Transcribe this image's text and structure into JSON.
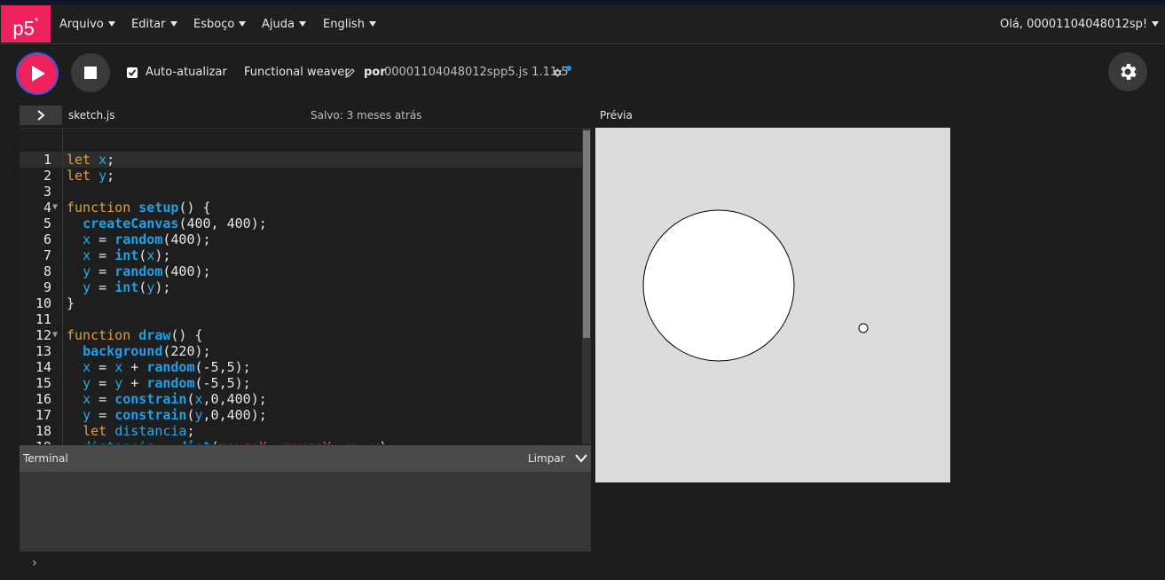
{
  "nav": {
    "logo": "p5",
    "logo_star": "*",
    "menus": [
      "Arquivo",
      "Editar",
      "Esboço",
      "Ajuda",
      "English"
    ],
    "user": "Olá, 00001104048012sp!"
  },
  "toolbar": {
    "auto_refresh": "Auto-atualizar",
    "sketch_name": "Functional weaver",
    "by": "por",
    "author": "00001104048012sp",
    "version": "p5.js 1.11.5"
  },
  "editor": {
    "filename": "sketch.js",
    "saved": "Salvo: 3 meses atrás",
    "preview_label": "Prévia",
    "lines": [
      "let x;",
      "let y;",
      "",
      "function setup() {",
      "  createCanvas(400, 400);",
      "  x = random(400);",
      "  x = int(x);",
      "  y = random(400);",
      "  y = int(y);",
      "}",
      "",
      "function draw() {",
      "  background(220);",
      "  x = x + random(-5,5);",
      "  y = y + random(-5,5);",
      "  x = constrain(x,0,400);",
      "  y = constrain(y,0,400);",
      "  let distancia;",
      "  distancia = dist(mouseX, mouseY, x, y);"
    ]
  },
  "console": {
    "title": "Terminal",
    "clear": "Limpar",
    "prompt": "›"
  },
  "colors": {
    "accent": "#ed225d",
    "keyword": "#d9a048",
    "function": "#1fa0e8",
    "mouse_var": "#d14e8c",
    "canvas_bg": "#dcdcdc"
  }
}
